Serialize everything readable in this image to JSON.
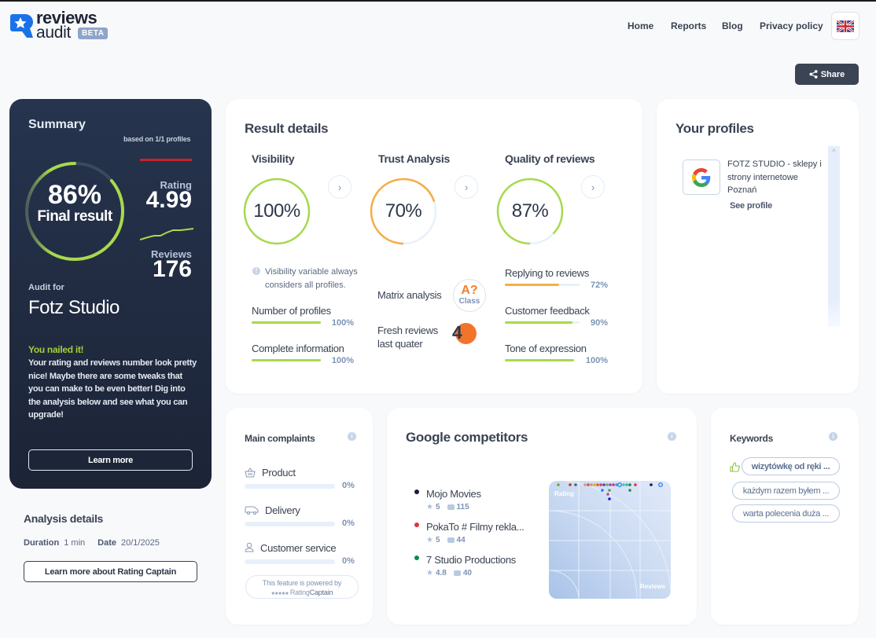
{
  "header": {
    "logo_line1": "reviews",
    "logo_line2": "audit",
    "badge": "BETA",
    "nav": [
      {
        "label": "Home"
      },
      {
        "label": "Reports"
      },
      {
        "label": "Blog"
      },
      {
        "label": "Privacy policy"
      }
    ],
    "language_icon": "uk-flag-icon",
    "share_label": "Share",
    "share_icon": "share-icon"
  },
  "summary": {
    "title": "Summary",
    "based_on": "based on 1/1 profiles",
    "final_result_pct": "86%",
    "final_result_value": 86,
    "final_result_label": "Final result",
    "rating_label": "Rating",
    "rating_value": "4.99",
    "reviews_label": "Reviews",
    "reviews_value": "176",
    "audit_for_label": "Audit for",
    "audit_name": "Fotz Studio",
    "headline": "You nailed it!",
    "message": "Your rating and reviews number look pretty nice! Maybe there are some tweaks that you can make to be even better! Dig into the analysis below and see what you can upgrade!",
    "learn_more_label": "Learn more"
  },
  "analysis_details": {
    "title": "Analysis details",
    "duration_label": "Duration",
    "duration_value": "1 min",
    "date_label": "Date",
    "date_value": "20/1/2025",
    "button_label": "Learn more about Rating Captain"
  },
  "result_details": {
    "title": "Result details",
    "columns": [
      {
        "title": "Visibility",
        "value": 100,
        "label": "100%",
        "color": "#a8d94c"
      },
      {
        "title": "Trust Analysis",
        "value": 70,
        "label": "70%",
        "color": "#f5ae45"
      },
      {
        "title": "Quality of reviews",
        "value": 87,
        "label": "87%",
        "color": "#a8d94c"
      }
    ],
    "visibility_note": "Visibility variable always considers all profiles.",
    "visibility_metrics": [
      {
        "label": "Number of profiles",
        "value": 100,
        "pct": "100%",
        "color": "#a8d94c"
      },
      {
        "label": "Complete information",
        "value": 100,
        "pct": "100%",
        "color": "#a8d94c"
      }
    ],
    "matrix_label": "Matrix analysis",
    "matrix_class": "A?",
    "matrix_class_sub": "Class",
    "fresh_label_line1": "Fresh reviews",
    "fresh_label_line2": "last quater",
    "fresh_value": "4",
    "quality_metrics": [
      {
        "label": "Replying to reviews",
        "value": 72,
        "pct": "72%",
        "color": "#f5ae45"
      },
      {
        "label": "Customer feedback",
        "value": 90,
        "pct": "90%",
        "color": "#a8d94c"
      },
      {
        "label": "Tone of expression",
        "value": 100,
        "pct": "100%",
        "color": "#a8d94c"
      }
    ]
  },
  "your_profiles": {
    "title": "Your profiles",
    "profiles": [
      {
        "name": "FOTZ STUDIO - sklepy i strony internetowe Poznań",
        "platform_icon": "google-icon",
        "link_label": "See profile"
      }
    ]
  },
  "main_complaints": {
    "title": "Main complaints",
    "items": [
      {
        "label": "Product",
        "icon": "basket-icon",
        "value": 0,
        "pct": "0%"
      },
      {
        "label": "Delivery",
        "icon": "truck-icon",
        "value": 0,
        "pct": "0%"
      },
      {
        "label": "Customer service",
        "icon": "person-icon",
        "value": 0,
        "pct": "0%"
      }
    ],
    "powered_line1": "This feature is powered by",
    "powered_line2_stars": "★★★★★",
    "powered_brand_a": "Rating",
    "powered_brand_b": "Captain"
  },
  "google_competitors": {
    "title": "Google competitors",
    "competitors": [
      {
        "name": "Mojo Movies",
        "rating": "5",
        "reviews": "115",
        "color": "#1e1b3a"
      },
      {
        "name": "PokaTo # Filmy rekla...",
        "rating": "5",
        "reviews": "44",
        "color": "#e0323f"
      },
      {
        "name": "7 Studio Productions",
        "rating": "4.8",
        "reviews": "40",
        "color": "#0f8a4e"
      }
    ],
    "plot_y_label": "Rating",
    "plot_x_label": "Reviews"
  },
  "keywords": {
    "title": "Keywords",
    "items": [
      {
        "label": "wizytówkę od ręki ...",
        "highlighted": true
      },
      {
        "label": "każdym razem byłem ...",
        "highlighted": false
      },
      {
        "label": "warta polecenia duża ...",
        "highlighted": false
      }
    ]
  }
}
